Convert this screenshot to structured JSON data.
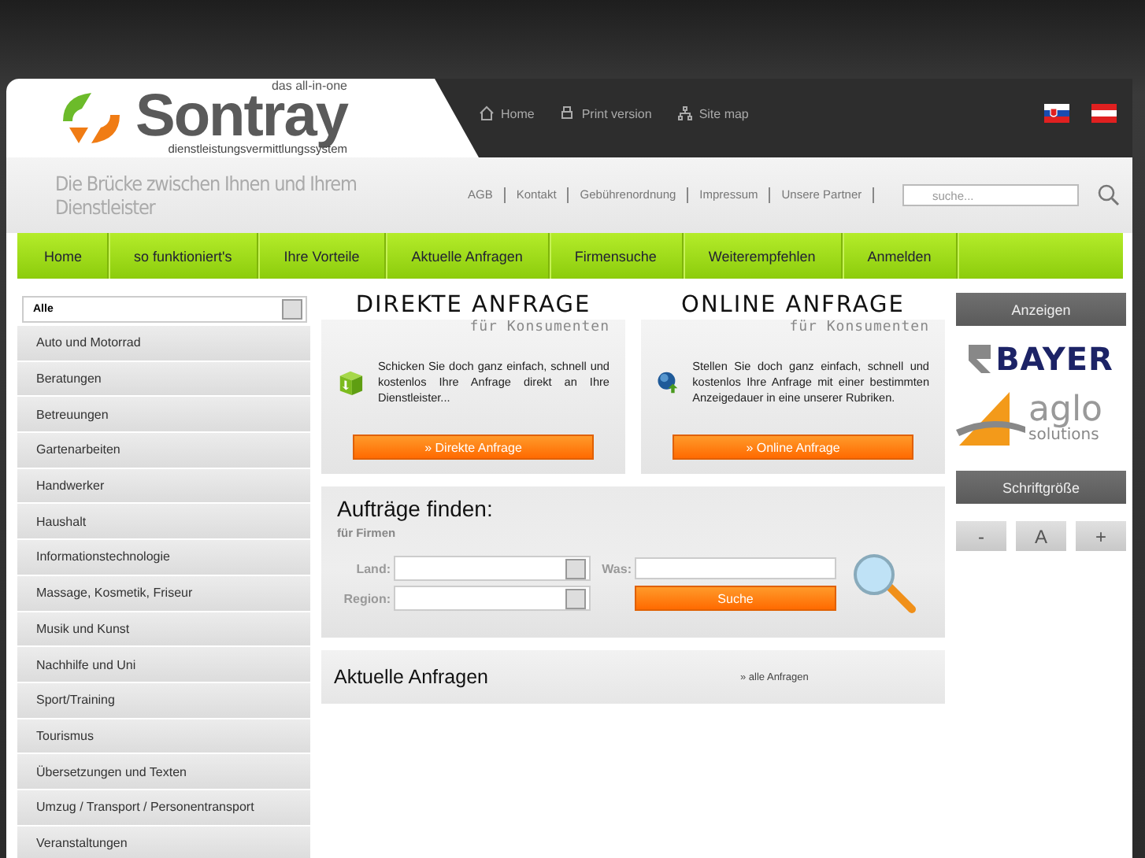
{
  "logo": {
    "name": "Sontray",
    "tagline": "das all-in-one",
    "subtitle": "dienstleistungsvermittlungssystem"
  },
  "top_links": [
    {
      "label": "Home",
      "kind": "home"
    },
    {
      "label": "Print version",
      "kind": "print"
    },
    {
      "label": "Site map",
      "kind": "sitemap"
    }
  ],
  "languages": [
    {
      "kind": "sk"
    },
    {
      "kind": "at"
    }
  ],
  "slogan": "Die Brücke zwischen Ihnen und Ihrem Dienstleister",
  "service_links": [
    "AGB",
    "Kontakt",
    "Gebührenordnung",
    "Impressum",
    "Unsere Partner"
  ],
  "search": {
    "placeholder": "suche..."
  },
  "nav": [
    "Home",
    "so funktioniert's",
    "Ihre Vorteile",
    "Aktuelle Anfragen",
    "Firmensuche",
    "Weiterempfehlen",
    "Anmelden"
  ],
  "category_select": {
    "value": "Alle"
  },
  "categories": [
    "Auto und Motorrad",
    "Beratungen",
    "Betreuungen",
    "Gartenarbeiten",
    "Handwerker",
    "Haushalt",
    "Informationstechnologie",
    "Massage, Kosmetik, Friseur",
    "Musik und Kunst",
    "Nachhilfe und Uni",
    "Sport/Training",
    "Tourismus",
    "Übersetzungen und Texten",
    "Umzug / Transport / Personentransport",
    "Veranstaltungen"
  ],
  "offers": [
    {
      "kind": "box",
      "title": "DIREKTE ANFRAGE",
      "subtitle": "für Konsumenten",
      "text": "Schicken Sie doch ganz einfach, schnell und kostenlos Ihre Anfrage direkt an Ihre Dienstleister...",
      "button": "» Direkte Anfrage"
    },
    {
      "kind": "globe",
      "title": "ONLINE ANFRAGE",
      "subtitle": "für Konsumenten",
      "text": "Stellen Sie doch ganz einfach, schnell und kostenlos Ihre Anfrage mit einer bestimmten Anzeigedauer in eine unserer Rubriken.",
      "button": "» Online Anfrage"
    }
  ],
  "finder": {
    "title": "Aufträge finden:",
    "subtitle": "für Firmen",
    "land_label": "Land:",
    "region_label": "Region:",
    "was_label": "Was:",
    "button": "Suche"
  },
  "requests": {
    "title": "Aktuelle Anfragen",
    "link": "» alle Anfragen"
  },
  "ads": {
    "title": "Anzeigen",
    "sponsors": [
      {
        "kind": "bayer",
        "name": "BAYER"
      },
      {
        "kind": "aglo",
        "name": "aglo",
        "sub": "solutions"
      }
    ]
  },
  "font_size": {
    "title": "Schriftgröße",
    "buttons": [
      "-",
      "A",
      "+"
    ]
  }
}
